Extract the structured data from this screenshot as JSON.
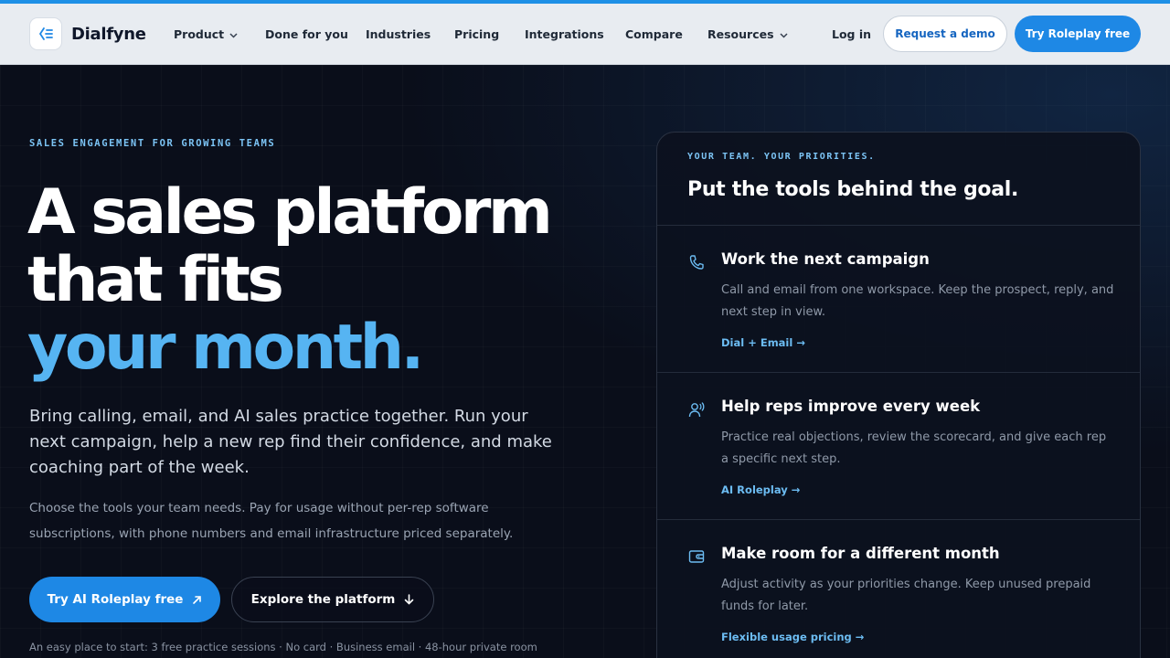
{
  "brand": {
    "name": "Dialfyne",
    "logo_icon": "signal-waves-icon",
    "accent": "#1e88e5"
  },
  "nav": {
    "items": [
      {
        "label": "Product",
        "dropdown": true
      },
      {
        "label": "Done for you",
        "dropdown": false
      },
      {
        "label": "Industries",
        "dropdown": false
      },
      {
        "label": "Pricing",
        "dropdown": false
      },
      {
        "label": "Integrations",
        "dropdown": false
      },
      {
        "label": "Compare",
        "dropdown": false
      },
      {
        "label": "Resources",
        "dropdown": true
      }
    ],
    "login_label": "Log in",
    "demo_label": "Request a demo",
    "try_label": "Try Roleplay free"
  },
  "hero": {
    "eyebrow": "SALES ENGAGEMENT FOR GROWING TEAMS",
    "headline_line1": "A sales platform",
    "headline_line2": "that fits",
    "headline_accent": "your month.",
    "lead": "Bring calling, email, and AI sales practice together. Run your next campaign, help a new rep find their confidence, and make coaching part of the week.",
    "sub": "Choose the tools your team needs. Pay for usage without per-rep software subscriptions, with phone numbers and email infrastructure priced separately.",
    "cta_primary": "Try AI Roleplay free",
    "cta_secondary": "Explore the platform",
    "footnote": "An easy place to start: 3 free practice sessions · No card · Business email · 48-hour private room"
  },
  "card": {
    "eyebrow": "YOUR TEAM. YOUR PRIORITIES.",
    "title": "Put the tools behind the goal.",
    "features": [
      {
        "icon": "phone-icon",
        "title": "Work the next campaign",
        "desc": "Call and email from one workspace. Keep the prospect, reply, and next step in view.",
        "link": "Dial + Email →"
      },
      {
        "icon": "user-voice-icon",
        "title": "Help reps improve every week",
        "desc": "Practice real objections, review the scorecard, and give each rep a specific next step.",
        "link": "AI Roleplay →"
      },
      {
        "icon": "wallet-icon",
        "title": "Make room for a different month",
        "desc": "Adjust activity as your priorities change. Keep unused prepaid funds for later.",
        "link": "Flexible usage pricing →"
      }
    ]
  }
}
